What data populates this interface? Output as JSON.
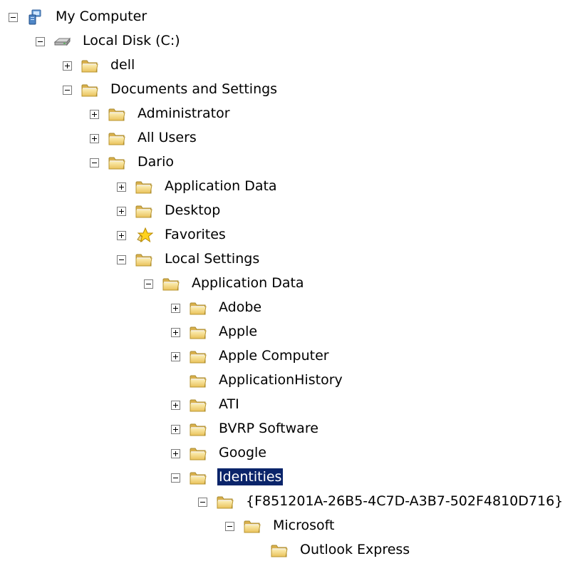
{
  "tree": {
    "my_computer": "My Computer",
    "local_disk": "Local Disk (C:)",
    "dell": "dell",
    "documents_and_settings": "Documents and Settings",
    "administrator": "Administrator",
    "all_users": "All Users",
    "dario": "Dario",
    "application_data": "Application Data",
    "desktop": "Desktop",
    "favorites": "Favorites",
    "local_settings": "Local Settings",
    "ls_application_data": "Application Data",
    "adobe": "Adobe",
    "apple": "Apple",
    "apple_computer": "Apple Computer",
    "application_history": "ApplicationHistory",
    "ati": "ATI",
    "bvrp_software": "BVRP Software",
    "google": "Google",
    "identities": "Identities",
    "guid": "{F851201A-26B5-4C7D-A3B7-502F4810D716}",
    "microsoft": "Microsoft",
    "outlook_express": "Outlook Express"
  },
  "selected_item": "Identities",
  "colors": {
    "folder": "#f4d77a",
    "selection": "#0a246a"
  }
}
